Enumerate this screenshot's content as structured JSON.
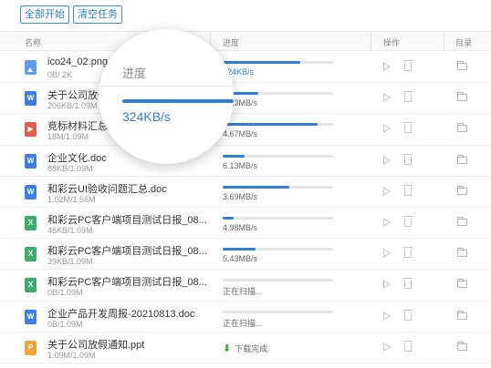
{
  "toolbar": {
    "start_all": "全部开始",
    "clear_tasks": "清空任务"
  },
  "header": {
    "name": "名称",
    "progress": "进度",
    "actions": "操作",
    "folder": "目录"
  },
  "magnifier": {
    "label": "进度",
    "speed": "324KB/s"
  },
  "files": [
    {
      "name": "ico24_02.png",
      "size": "0B/ 2K",
      "type": "image",
      "progress": 0.7,
      "status": "324KB/s"
    },
    {
      "name": "关于公司放假通知.docx",
      "size": "206KB/1.09M",
      "type": "doc",
      "progress": 0.32,
      "status": "5.23MB/s"
    },
    {
      "name": "竞标材料汇总.mp4",
      "size": "18M/1.09M",
      "type": "video",
      "progress": 0.86,
      "status": "4.67MB/s"
    },
    {
      "name": "企业文化.doc",
      "size": "88KB/1.09M",
      "type": "doc",
      "progress": 0.2,
      "status": "6.13MB/s"
    },
    {
      "name": "和彩云UI验收问题汇总.doc",
      "size": "1.02M/1.56M",
      "type": "doc",
      "progress": 0.6,
      "status": "3.69MB/s"
    },
    {
      "name": "和彩云PC客户端项目测试日报_08...",
      "size": "46KB/1.09M",
      "type": "xls",
      "progress": 0.1,
      "status": "4.98MB/s"
    },
    {
      "name": "和彩云PC客户端项目测试日报_08...",
      "size": "39KB/1.09M",
      "type": "xls",
      "progress": 0.3,
      "status": "5.43MB/s"
    },
    {
      "name": "和彩云PC客户端项目测试日报_08...",
      "size": "0B/1.09M",
      "type": "xls",
      "progress": 0.0,
      "status": "正在扫描..."
    },
    {
      "name": "企业产品开发周报-20210813.doc",
      "size": "0B/1.09M",
      "type": "doc",
      "progress": 0.0,
      "status": "正在扫描..."
    },
    {
      "name": "关于公司放假通知.ppt",
      "size": "1.09M/1.09M",
      "type": "ppt",
      "progress": 1.0,
      "status": "下载完成"
    }
  ],
  "colors": {
    "accent": "#2f7fd9",
    "track": "#e4e4e4",
    "done": "#3dad3d"
  },
  "icons": {
    "image": {
      "glyph": "",
      "name": "image-file-icon"
    },
    "doc": {
      "glyph": "W",
      "name": "word-file-icon"
    },
    "video": {
      "glyph": "▶",
      "name": "video-file-icon"
    },
    "xls": {
      "glyph": "X",
      "name": "excel-file-icon"
    },
    "ppt": {
      "glyph": "P",
      "name": "ppt-file-icon"
    }
  }
}
